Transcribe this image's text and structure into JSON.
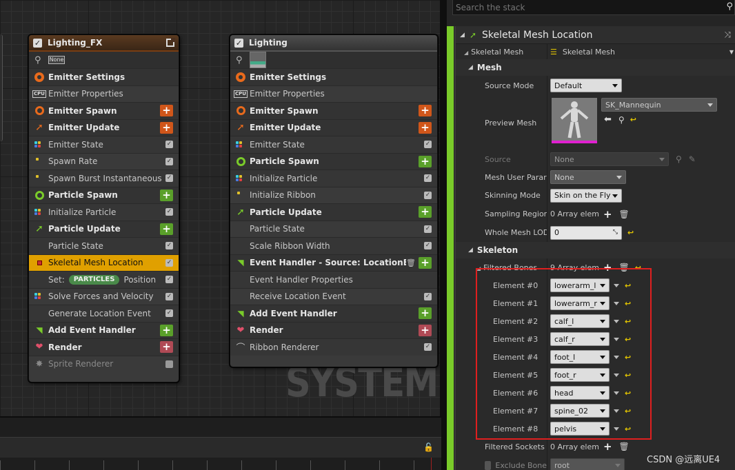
{
  "watermark": "SYSTEM",
  "nodes": [
    {
      "title": "Lighting_FX",
      "thumb_label": "None",
      "rows": [
        {
          "label": "Emitter Settings",
          "kind": "sec",
          "icon": "gear"
        },
        {
          "label": "Emitter Properties",
          "kind": "item",
          "icon": "cpu"
        },
        {
          "label": "Emitter Spawn",
          "kind": "sec",
          "icon": "ring",
          "add": "orange"
        },
        {
          "label": "Emitter Update",
          "kind": "sec",
          "icon": "arrow",
          "add": "orange"
        },
        {
          "label": "Emitter State",
          "kind": "item",
          "icon": "dots",
          "check": true
        },
        {
          "label": "Spawn Rate",
          "kind": "item",
          "icon": "dot",
          "check": true
        },
        {
          "label": "Spawn Burst Instantaneous",
          "kind": "item",
          "icon": "dot",
          "check": true
        },
        {
          "label": "Particle Spawn",
          "kind": "sec",
          "icon": "ring-g",
          "add": "green"
        },
        {
          "label": "Initialize Particle",
          "kind": "item",
          "icon": "dots",
          "check": true
        },
        {
          "label": "Particle Update",
          "kind": "sec",
          "icon": "arrow-g",
          "add": "green"
        },
        {
          "label": "Particle State",
          "kind": "item",
          "icon": "",
          "check": true
        },
        {
          "label": "Skeletal Mesh Location",
          "kind": "hl",
          "icon": "sq",
          "check": true
        },
        {
          "label": "Set:",
          "kind": "item",
          "icon": "",
          "check": true,
          "pill": "PARTICLES",
          "suffix": "Position"
        },
        {
          "label": "Solve Forces and Velocity",
          "kind": "item",
          "icon": "dots",
          "check": true
        },
        {
          "label": "Generate Location Event",
          "kind": "item",
          "icon": "",
          "check": true
        },
        {
          "label": "Add Event Handler",
          "kind": "sec",
          "icon": "wifi",
          "add": "green"
        },
        {
          "label": "Render",
          "kind": "sec",
          "icon": "render",
          "add": "red"
        },
        {
          "label": "Sprite Renderer",
          "kind": "dim",
          "icon": "star",
          "check": false
        }
      ]
    },
    {
      "title": "Lighting",
      "thumb_label": "",
      "rows": [
        {
          "label": "Emitter Settings",
          "kind": "sec",
          "icon": "gear"
        },
        {
          "label": "Emitter Properties",
          "kind": "item",
          "icon": "cpu"
        },
        {
          "label": "Emitter Spawn",
          "kind": "sec",
          "icon": "ring",
          "add": "orange"
        },
        {
          "label": "Emitter Update",
          "kind": "sec",
          "icon": "arrow",
          "add": "orange"
        },
        {
          "label": "Emitter State",
          "kind": "item",
          "icon": "dots",
          "check": true
        },
        {
          "label": "Particle Spawn",
          "kind": "sec",
          "icon": "ring-g",
          "add": "green"
        },
        {
          "label": "Initialize Particle",
          "kind": "item",
          "icon": "dots",
          "check": true
        },
        {
          "label": "Initialize Ribbon",
          "kind": "item",
          "icon": "dot",
          "check": true
        },
        {
          "label": "Particle Update",
          "kind": "sec",
          "icon": "arrow-g",
          "add": "green"
        },
        {
          "label": "Particle State",
          "kind": "item",
          "icon": "",
          "check": true
        },
        {
          "label": "Scale Ribbon Width",
          "kind": "item",
          "icon": "",
          "check": true
        },
        {
          "label": "Event Handler - Source: LocationEvent",
          "kind": "sec",
          "icon": "wifi",
          "add": "green",
          "trash": true
        },
        {
          "label": "Event Handler Properties",
          "kind": "item",
          "icon": ""
        },
        {
          "label": "Receive Location Event",
          "kind": "item",
          "icon": "",
          "check": true
        },
        {
          "label": "Add Event Handler",
          "kind": "sec",
          "icon": "wifi",
          "add": "green"
        },
        {
          "label": "Render",
          "kind": "sec",
          "icon": "render",
          "add": "red"
        },
        {
          "label": "Ribbon Renderer",
          "kind": "item",
          "icon": "ribbon",
          "check": true
        }
      ]
    }
  ],
  "stack": {
    "search_placeholder": "Search the stack",
    "title": "Skeletal Mesh Location",
    "skeletal_mesh_label": "Skeletal Mesh",
    "skeletal_mesh_value": "Skeletal Mesh",
    "mesh_category": "Mesh",
    "source_mode_label": "Source Mode",
    "source_mode_value": "Default",
    "preview_mesh_label": "Preview Mesh",
    "preview_mesh_value": "SK_Mannequin",
    "source_label": "Source",
    "source_value": "None",
    "mesh_user_param_label": "Mesh User Parar",
    "mesh_user_param_value": "None",
    "skinning_mode_label": "Skinning Mode",
    "skinning_mode_value": "Skin on the Fly",
    "sampling_region_label": "Sampling Region",
    "sampling_region_value": "0 Array elem",
    "whole_mesh_lod_label": "Whole Mesh LOD",
    "whole_mesh_lod_value": "0",
    "skeleton_category": "Skeleton",
    "filtered_bones_label": "Filtered Bones",
    "filtered_bones_value": "9 Array elem",
    "elements": [
      {
        "label": "Element #0",
        "value": "lowerarm_l"
      },
      {
        "label": "Element #1",
        "value": "lowerarm_r"
      },
      {
        "label": "Element #2",
        "value": "calf_l"
      },
      {
        "label": "Element #3",
        "value": "calf_r"
      },
      {
        "label": "Element #4",
        "value": "foot_l"
      },
      {
        "label": "Element #5",
        "value": "foot_r"
      },
      {
        "label": "Element #6",
        "value": "head"
      },
      {
        "label": "Element #7",
        "value": "spine_02"
      },
      {
        "label": "Element #8",
        "value": "pelvis"
      }
    ],
    "filtered_sockets_label": "Filtered Sockets",
    "filtered_sockets_value": "0 Array elem",
    "exclude_bone_label": "Exclude Bone",
    "exclude_bone_value": "root"
  },
  "credit": "CSDN @远离UE4",
  "colors": {
    "accent_green": "#7acb2a",
    "highlight": "#e0a000",
    "annotation_red": "#e01f1f"
  }
}
